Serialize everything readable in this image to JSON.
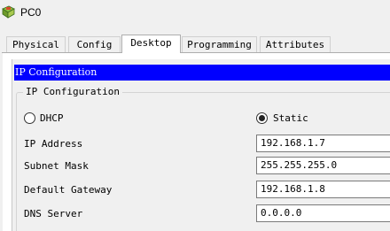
{
  "window": {
    "title": "PC0",
    "icon": "pc-app-icon"
  },
  "tabs": [
    {
      "label": "Physical",
      "active": false
    },
    {
      "label": "Config",
      "active": false
    },
    {
      "label": "Desktop",
      "active": true
    },
    {
      "label": "Programming",
      "active": false
    },
    {
      "label": "Attributes",
      "active": false
    }
  ],
  "panel": {
    "header": "IP Configuration"
  },
  "ip_config": {
    "group_title": "IP Configuration",
    "mode": {
      "dhcp_label": "DHCP",
      "static_label": "Static",
      "selected": "Static"
    },
    "fields": {
      "ip_address": {
        "label": "IP Address",
        "value": "192.168.1.7"
      },
      "subnet_mask": {
        "label": "Subnet Mask",
        "value": "255.255.255.0"
      },
      "default_gateway": {
        "label": "Default Gateway",
        "value": "192.168.1.8"
      },
      "dns_server": {
        "label": "DNS Server",
        "value": "0.0.0.0"
      }
    }
  },
  "colors": {
    "header_bg": "#0000ff",
    "header_text": "#ffffff",
    "window_bg": "#f0f0f0"
  }
}
